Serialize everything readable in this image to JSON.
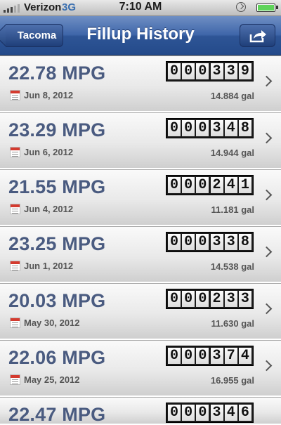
{
  "status_bar": {
    "carrier": "Verizon",
    "network": "3G",
    "time": "7:10 AM"
  },
  "nav": {
    "back_label": "Tacoma",
    "title": "Fillup History",
    "share_icon": "share-icon"
  },
  "fillups": [
    {
      "mpg": "22.78 MPG",
      "date": "Jun 8, 2012",
      "odometer": "000339",
      "gallons": "14.884 gal"
    },
    {
      "mpg": "23.29 MPG",
      "date": "Jun 6, 2012",
      "odometer": "000348",
      "gallons": "14.944 gal"
    },
    {
      "mpg": "21.55 MPG",
      "date": "Jun 4, 2012",
      "odometer": "000241",
      "gallons": "11.181 gal"
    },
    {
      "mpg": "23.25 MPG",
      "date": "Jun 1, 2012",
      "odometer": "000338",
      "gallons": "14.538 gal"
    },
    {
      "mpg": "20.03 MPG",
      "date": "May 30, 2012",
      "odometer": "000233",
      "gallons": "11.630 gal"
    },
    {
      "mpg": "22.06 MPG",
      "date": "May 25, 2012",
      "odometer": "000374",
      "gallons": "16.955 gal"
    }
  ],
  "partial_row": {
    "mpg": "22.47 MPG",
    "odometer": "000346"
  }
}
